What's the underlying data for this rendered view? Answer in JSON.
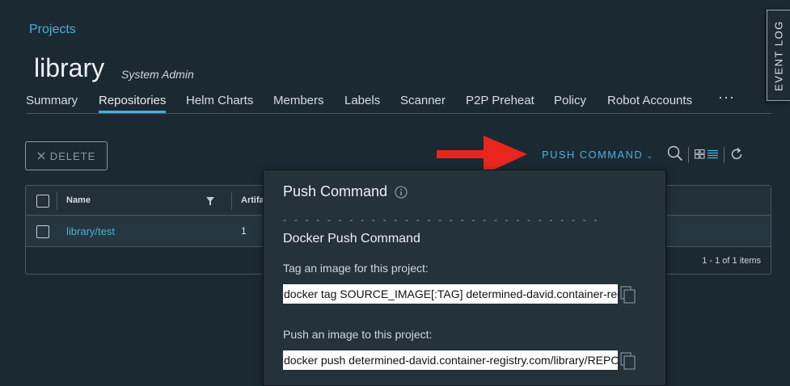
{
  "breadcrumb": "Projects",
  "project": {
    "name": "library",
    "role": "System Admin"
  },
  "tabs": [
    {
      "label": "Summary"
    },
    {
      "label": "Repositories"
    },
    {
      "label": "Helm Charts"
    },
    {
      "label": "Members"
    },
    {
      "label": "Labels"
    },
    {
      "label": "Scanner"
    },
    {
      "label": "P2P Preheat"
    },
    {
      "label": "Policy"
    },
    {
      "label": "Robot Accounts"
    }
  ],
  "tab_more": "···",
  "event_log": "EVENT LOG",
  "toolbar": {
    "delete_label": "DELETE",
    "push_command_label": "PUSH COMMAND"
  },
  "grid": {
    "headers": {
      "name": "Name",
      "artifacts": "Artifa"
    },
    "rows": [
      {
        "name": "library/test",
        "artifacts": "1"
      }
    ],
    "footer": "1 - 1 of 1 items"
  },
  "popover": {
    "title": "Push Command",
    "dashes": "- - - - - - - - - - - - - - - - - - - - - - - - - - - - - - - - - - - - - - - - - -",
    "subtitle": "Docker Push Command",
    "tag_label": "Tag an image for this project:",
    "tag_command": "docker tag SOURCE_IMAGE[:TAG] determined-david.container-registry.com/library/REPOSITORY[:TAG]",
    "push_label": "Push an image to this project:",
    "push_command": "docker push determined-david.container-registry.com/library/REPOSITORY[:TAG]"
  },
  "colors": {
    "background": "#1b2a32",
    "accent": "#4aaed9",
    "arrow": "#e8261e",
    "popover": "#24323a"
  }
}
